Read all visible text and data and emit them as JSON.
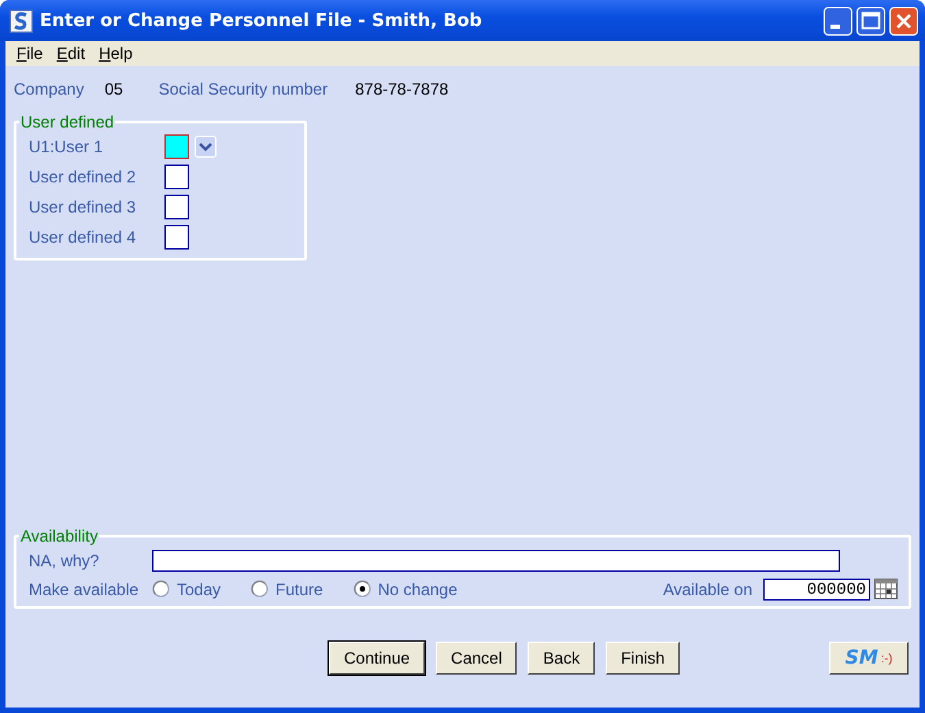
{
  "window": {
    "title": "Enter or Change Personnel File - Smith, Bob"
  },
  "menu": [
    {
      "label": "File"
    },
    {
      "label": "Edit"
    },
    {
      "label": "Help"
    }
  ],
  "header": {
    "company_label": "Company",
    "company": "05",
    "ssn_label": "Social Security number",
    "ssn": "878-78-7878"
  },
  "user_defined": {
    "title": "User defined",
    "fields": [
      {
        "label": "U1:User 1",
        "kind": "dropdown",
        "color": "#00ffff",
        "focused": true
      },
      {
        "label": "User defined 2",
        "kind": "plain",
        "color": "#ffffff",
        "focused": false
      },
      {
        "label": "User defined 3",
        "kind": "plain",
        "color": "#ffffff",
        "focused": false
      },
      {
        "label": "User defined 4",
        "kind": "plain",
        "color": "#ffffff",
        "focused": false
      }
    ]
  },
  "availability": {
    "title": "Availability",
    "na_label": "NA, why?",
    "make_label": "Make available",
    "options": [
      {
        "label": "Today",
        "selected": false
      },
      {
        "label": "Future",
        "selected": false
      },
      {
        "label": "No change",
        "selected": true
      }
    ],
    "available_on_label": "Available on",
    "available_on": "000000"
  },
  "buttons": [
    {
      "label": "Continue",
      "default": true
    },
    {
      "label": "Cancel",
      "default": false
    },
    {
      "label": "Back",
      "default": false
    },
    {
      "label": "Finish",
      "default": false
    }
  ],
  "logo": {
    "letters": "SM",
    "smiley": ":-)"
  }
}
